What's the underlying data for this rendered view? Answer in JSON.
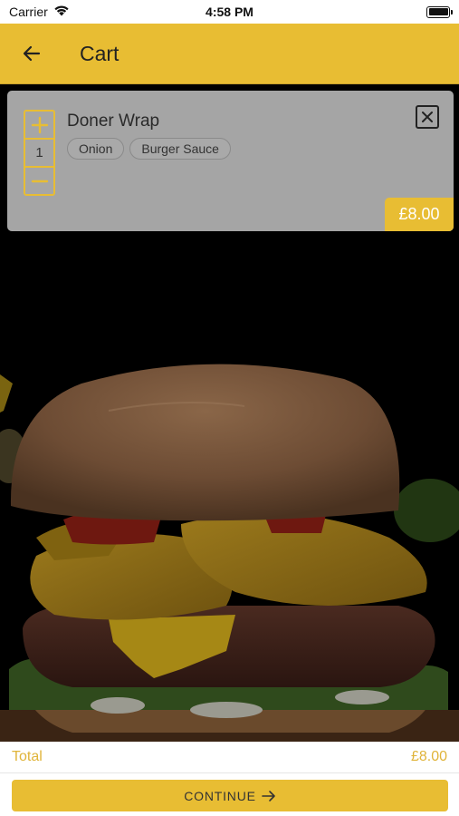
{
  "status_bar": {
    "carrier": "Carrier",
    "time": "4:58 PM"
  },
  "header": {
    "title": "Cart",
    "back_icon": "arrow-left-icon"
  },
  "cart": {
    "items": [
      {
        "name": "Doner Wrap",
        "quantity": "1",
        "options": [
          "Onion",
          "Burger Sauce"
        ],
        "price": "£8.00"
      }
    ]
  },
  "footer": {
    "total_label": "Total",
    "total_value": "£8.00",
    "continue_label": "CONTINUE"
  },
  "colors": {
    "accent": "#e8bd33",
    "card": "#acacac",
    "background": "#000000"
  }
}
